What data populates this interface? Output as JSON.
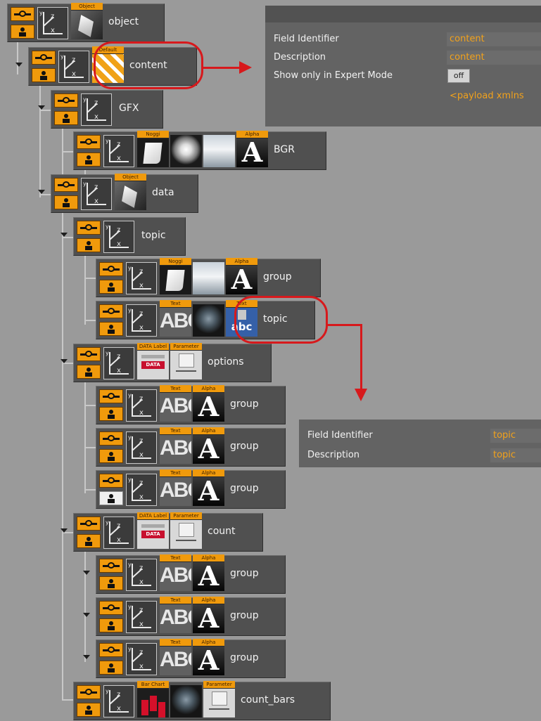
{
  "tree": {
    "container_names": [
      "object",
      "content",
      "GFX",
      "BGR",
      "data",
      "topic",
      "group",
      "topic",
      "options",
      "group",
      "group",
      "group",
      "count",
      "group",
      "group",
      "group",
      "count_bars"
    ],
    "tags": {
      "object": "Object",
      "default": "Default",
      "noggi": "Noggi",
      "alpha": "Alpha",
      "text": "Text",
      "data_label": "DATA Label",
      "parameter": "Parameter",
      "bar_chart": "Bar Chart"
    },
    "axis_labels": {
      "x": "x",
      "y": "y",
      "z": "z"
    },
    "text_glyphs": {
      "abc_upper": "ABC",
      "abc_lower": "abc",
      "alpha_glyph": "A"
    }
  },
  "content_panel": {
    "rows": [
      {
        "label": "Field Identifier",
        "value": "content"
      },
      {
        "label": "Description",
        "value": "content"
      },
      {
        "label": "Show only in Expert Mode",
        "button": "off"
      }
    ],
    "payload_text": "<payload xmlns"
  },
  "topic_panel": {
    "rows": [
      {
        "label": "Field Identifier",
        "value": "topic"
      },
      {
        "label": "Description",
        "value": "topic"
      }
    ]
  },
  "colors": {
    "background": "#9a9a9a",
    "node_bg": "#505050",
    "toggle_orange": "#f09a0c",
    "value_orange": "#f2a21b",
    "callout_red": "#d7191c"
  },
  "icons": [
    "expand-arrow-icon",
    "visibility-toggle-icon",
    "lock-toggle-icon",
    "axis-transform-icon",
    "object-icon",
    "default-icon",
    "noggi-icon",
    "material-icon",
    "texture-icon",
    "alpha-icon",
    "text-icon",
    "data-label-icon",
    "parameter-icon",
    "bar-chart-icon"
  ]
}
